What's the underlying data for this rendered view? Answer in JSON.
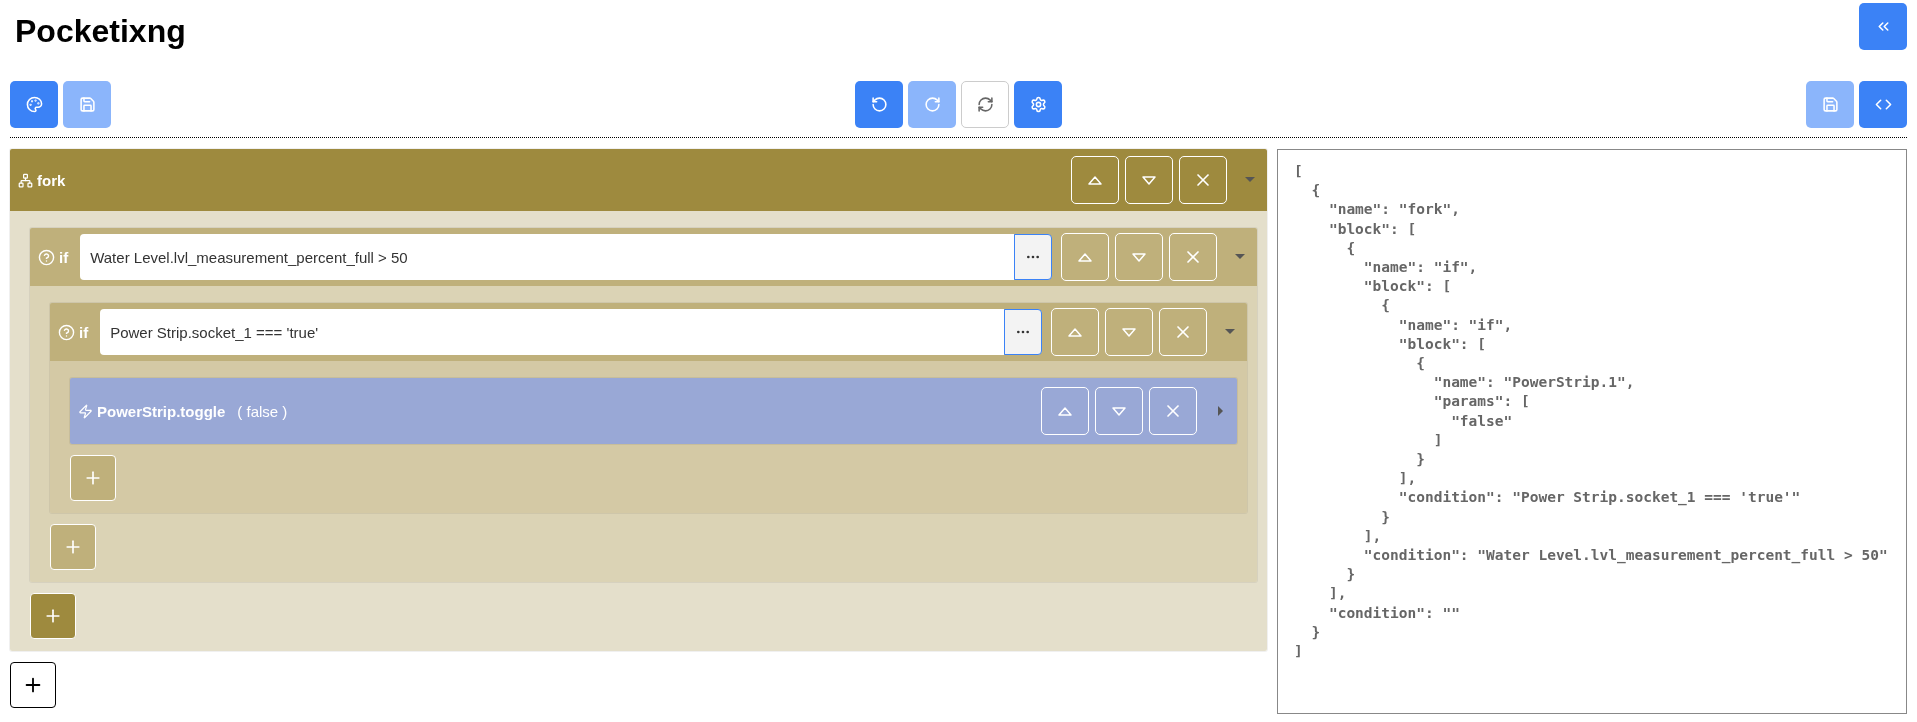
{
  "header": {
    "title": "Pocketixng",
    "buttons": [
      {
        "kind": "collapse",
        "disabled": false
      }
    ]
  },
  "toolbar": {
    "left": [
      {
        "kind": "palette",
        "disabled": false
      },
      {
        "kind": "save",
        "disabled": true
      }
    ],
    "center": [
      {
        "kind": "undo",
        "disabled": false
      },
      {
        "kind": "redo",
        "disabled": true
      },
      {
        "kind": "refresh",
        "disabled": false
      },
      {
        "kind": "settings",
        "disabled": false
      }
    ],
    "right": [
      {
        "kind": "save",
        "disabled": true
      },
      {
        "kind": "code",
        "disabled": false
      }
    ]
  },
  "blocks": [
    {
      "kind": "fork",
      "title": "fork",
      "expanded": true,
      "children": [
        {
          "kind": "if",
          "title": "if",
          "condition": "Water Level.lvl_measurement_percent_full > 50",
          "expanded": true,
          "children": [
            {
              "kind": "if",
              "title": "if",
              "condition": "Power Strip.socket_1 === 'true'",
              "expanded": true,
              "children": [
                {
                  "kind": "action",
                  "title": "PowerStrip.toggle",
                  "params": "( false )",
                  "expanded": false
                }
              ]
            }
          ]
        }
      ]
    }
  ],
  "code": "[\n  {\n    \"name\": \"fork\",\n    \"block\": [\n      {\n        \"name\": \"if\",\n        \"block\": [\n          {\n            \"name\": \"if\",\n            \"block\": [\n              {\n                \"name\": \"PowerStrip.1\",\n                \"params\": [\n                  \"false\"\n                ]\n              }\n            ],\n            \"condition\": \"Power Strip.socket_1 === 'true'\"\n          }\n        ],\n        \"condition\": \"Water Level.lvl_measurement_percent_full > 50\"\n      }\n    ],\n    \"condition\": \"\"\n  }\n]"
}
